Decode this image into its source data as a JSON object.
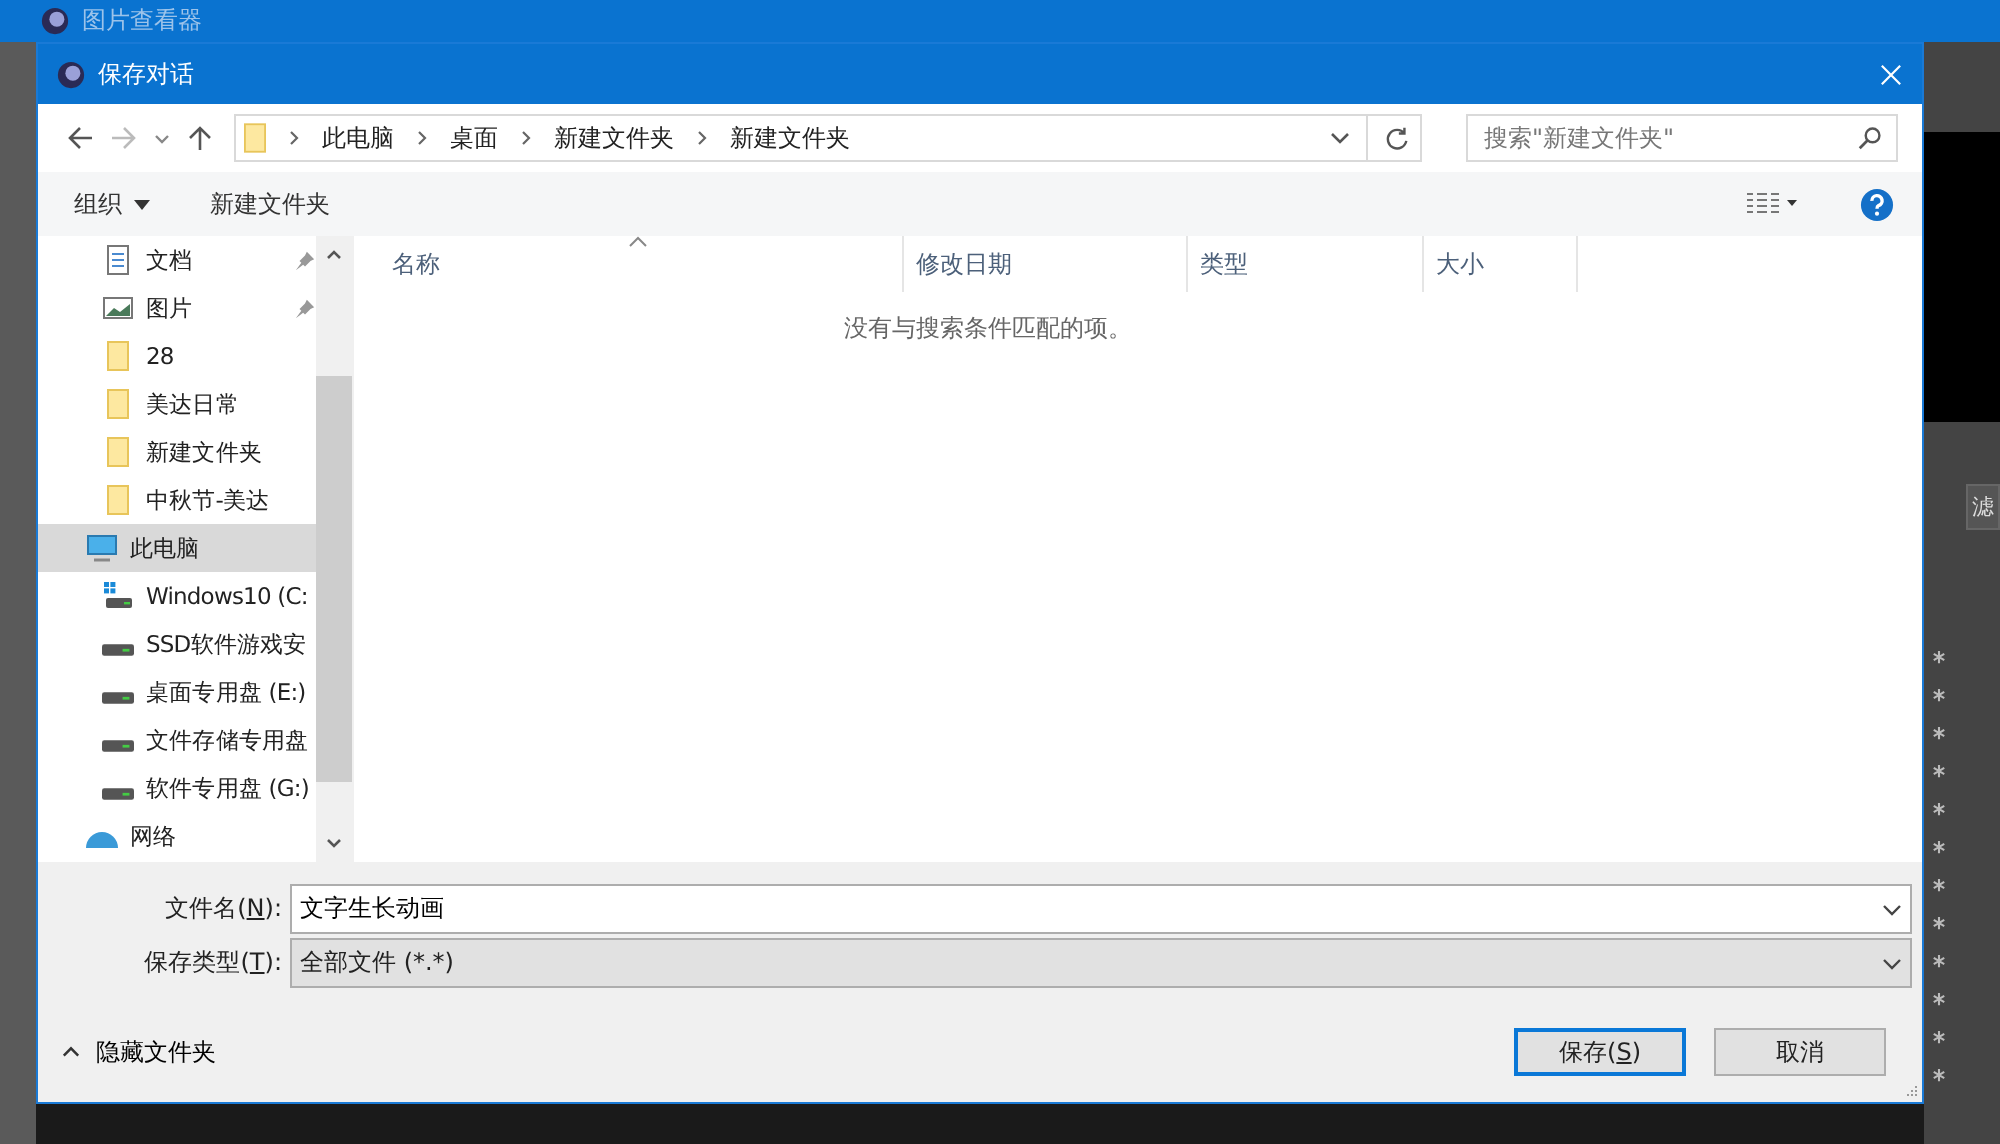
{
  "background_app": {
    "title": "图片查看器",
    "panel_tab": "滤"
  },
  "dialog": {
    "title": "保存对话",
    "address": {
      "crumbs": [
        "此电脑",
        "桌面",
        "新建文件夹",
        "新建文件夹"
      ]
    },
    "search": {
      "placeholder": "搜索\"新建文件夹\""
    },
    "toolbar": {
      "organize": "组织",
      "new_folder": "新建文件夹"
    },
    "sidebar": {
      "items": [
        {
          "kind": "document",
          "label": "文档",
          "pinned": true,
          "selected": false
        },
        {
          "kind": "picture",
          "label": "图片",
          "pinned": true,
          "selected": false
        },
        {
          "kind": "folder",
          "label": "28",
          "pinned": false,
          "selected": false
        },
        {
          "kind": "folder",
          "label": "美达日常",
          "pinned": false,
          "selected": false
        },
        {
          "kind": "folder",
          "label": "新建文件夹",
          "pinned": false,
          "selected": false
        },
        {
          "kind": "folder",
          "label": "中秋节-美达",
          "pinned": false,
          "selected": false
        },
        {
          "kind": "computer",
          "label": "此电脑",
          "pinned": false,
          "selected": true
        },
        {
          "kind": "system-drive",
          "label": "Windows10 (C:",
          "pinned": false,
          "selected": false
        },
        {
          "kind": "drive",
          "label": "SSD软件游戏安",
          "pinned": false,
          "selected": false
        },
        {
          "kind": "drive",
          "label": "桌面专用盘 (E:)",
          "pinned": false,
          "selected": false
        },
        {
          "kind": "drive",
          "label": "文件存储专用盘",
          "pinned": false,
          "selected": false
        },
        {
          "kind": "drive",
          "label": "软件专用盘 (G:)",
          "pinned": false,
          "selected": false
        },
        {
          "kind": "network",
          "label": "网络",
          "pinned": false,
          "selected": false
        }
      ]
    },
    "table": {
      "columns": [
        "名称",
        "修改日期",
        "类型",
        "大小"
      ],
      "empty_message": "没有与搜索条件匹配的项。"
    },
    "file_name": {
      "label_parts": [
        "文件名(",
        "N",
        "):"
      ],
      "value": "文字生长动画"
    },
    "file_type": {
      "label_parts": [
        "保存类型(",
        "T",
        "):"
      ],
      "value": "全部文件 (*.*)"
    },
    "hide_folders": "隐藏文件夹",
    "buttons": [
      {
        "label_parts": [
          "保存(",
          "S",
          ")"
        ],
        "default": true
      },
      {
        "label_parts": [
          "取消"
        ],
        "default": false
      }
    ]
  }
}
